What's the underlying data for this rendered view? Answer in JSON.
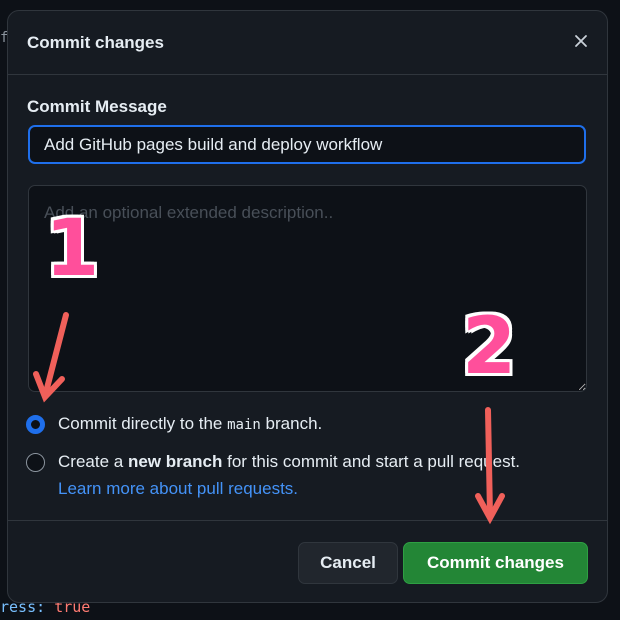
{
  "background": {
    "code_key": "ress:",
    "code_value": "true"
  },
  "modal": {
    "title": "Commit changes",
    "close_icon": "close-icon",
    "message_label": "Commit Message",
    "message_value": "Add GitHub pages build and deploy workflow",
    "description_placeholder": "Add an optional extended description..",
    "options": [
      {
        "selected": true,
        "text_before": "Commit directly to the ",
        "branch": "main",
        "text_after": " branch."
      },
      {
        "selected": false,
        "text_before": "Create a ",
        "bold": "new branch",
        "text_after": " for this commit and start a pull request."
      }
    ],
    "learn_more_link": "Learn more about pull requests.",
    "cancel_label": "Cancel",
    "commit_label": "Commit changes"
  },
  "annotations": {
    "step_1": "1",
    "step_2": "2"
  },
  "colors": {
    "accent": "#1f6feb",
    "primary_button": "#238636",
    "link": "#4493f8",
    "annotation": "#ff4f9b",
    "arrow": "#f0605a"
  }
}
